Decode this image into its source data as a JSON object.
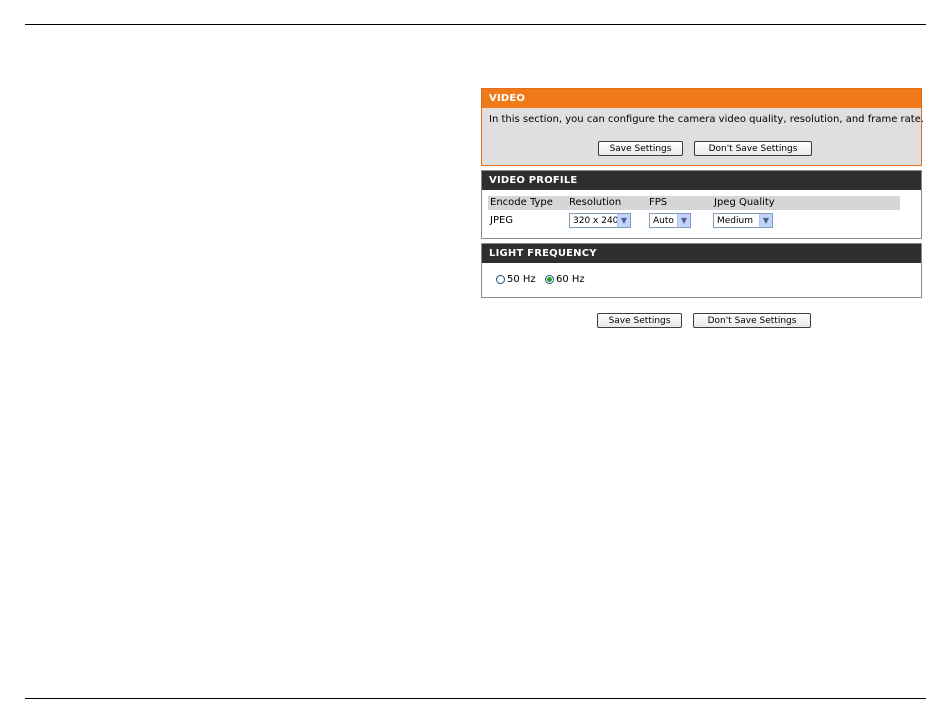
{
  "video": {
    "title": "VIDEO",
    "description": "In this section, you can configure the camera video quality, resolution, and frame rate.",
    "save_label": "Save Settings",
    "dont_save_label": "Don't Save Settings"
  },
  "profile": {
    "title": "VIDEO PROFILE",
    "columns": [
      "Encode Type",
      "Resolution",
      "FPS",
      "Jpeg Quality"
    ],
    "encode_type": "JPEG",
    "resolution": "320 x 240",
    "fps": "Auto",
    "jpeg_quality": "Medium"
  },
  "light": {
    "title": "LIGHT FREQUENCY",
    "option_50": "50 Hz",
    "option_60": "60 Hz",
    "selected": "60 Hz"
  },
  "footer": {
    "save_label": "Save Settings",
    "dont_save_label": "Don't Save Settings"
  },
  "colors": {
    "orange_header": "#f07a1a",
    "dark_header": "#2e2e2e",
    "panel_bg": "#dfdfdf",
    "radio_selected": "#2aa12a"
  },
  "icons": {
    "dropdown": "chevron-down-icon",
    "radio": "radio-button-icon"
  }
}
